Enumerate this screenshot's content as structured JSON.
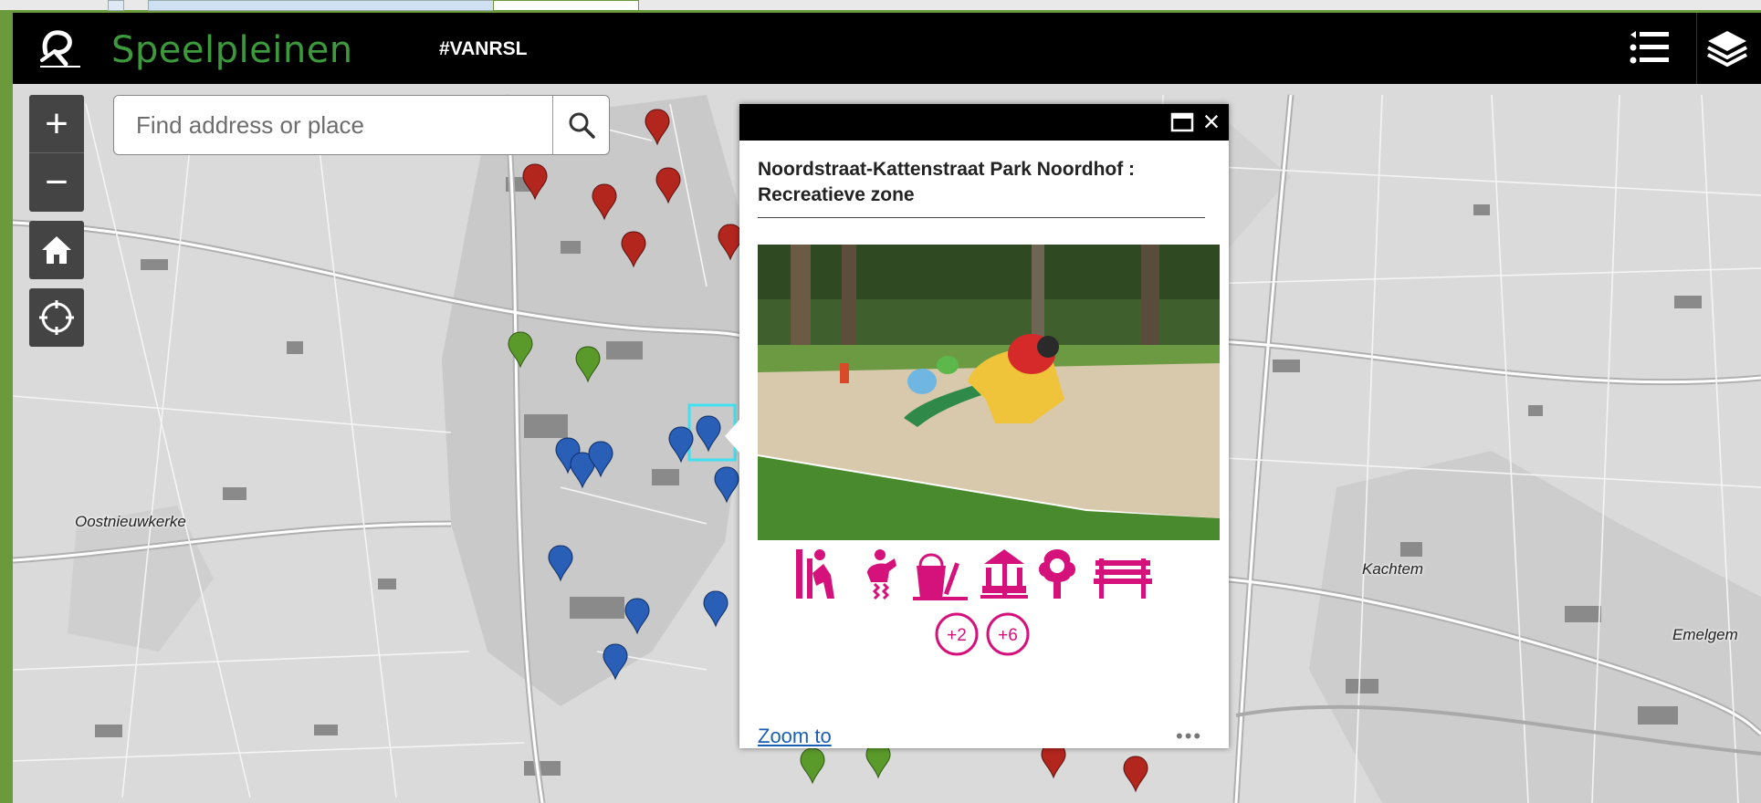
{
  "header": {
    "app_title": "Speelpleinen",
    "hashtag": "#VANRSL",
    "logo_icon": "poperinge-logo"
  },
  "search": {
    "placeholder": "Find address or place",
    "value": ""
  },
  "map_controls": {
    "zoom_in": "+",
    "zoom_out": "−",
    "home_icon": "home-icon",
    "locate_icon": "locate-icon"
  },
  "place_labels": {
    "oostnieuwkerke": "Oostnieuwkerke",
    "kachtem": "Kachtem",
    "emelgem": "Emelgem"
  },
  "popup": {
    "title": "Noordstraat-Kattenstraat Park Noordhof : Recreatieve zone",
    "amenity_icons": [
      "slide-icon",
      "spring-rider-icon",
      "sandbox-icon",
      "carousel-icon",
      "tree-icon",
      "bench-icon"
    ],
    "age_badges": [
      "+2",
      "+6"
    ],
    "zoom_to_label": "Zoom to",
    "more_label": "•••"
  },
  "colors": {
    "accent_green": "#3c9a3c",
    "amenity_pink": "#d5127c",
    "marker_red": "#b3261e",
    "marker_green": "#5a9a2a",
    "marker_blue": "#2a5fb8",
    "frame_green": "#6b9a3d"
  }
}
